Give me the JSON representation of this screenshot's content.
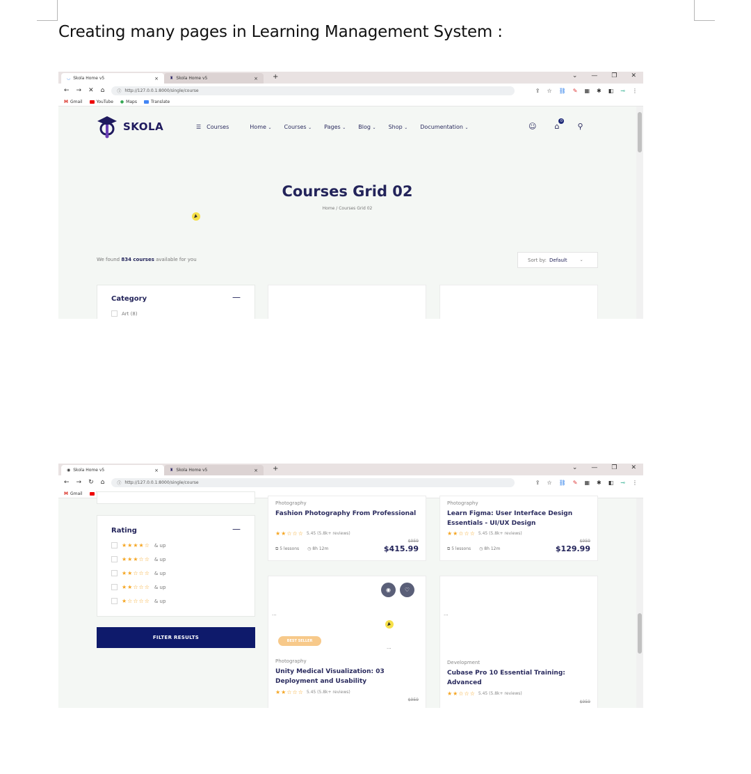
{
  "document": {
    "heading": "Creating many pages in Learning Management System :"
  },
  "browser": {
    "tab_title": "Skola Home v5",
    "tab_title_2": "Skola Home v5",
    "new_tab": "+",
    "tab_close": "×",
    "url": "http://127.0.0.1:8000/single/course",
    "bookmarks": [
      "Gmail",
      "YouTube",
      "Maps",
      "Translate"
    ],
    "window_controls": [
      "⌄",
      "—",
      "❐",
      "✕"
    ]
  },
  "site": {
    "logo_text": "SKOLA",
    "courses_button": "Courses",
    "nav": [
      "Home",
      "Courses",
      "Pages",
      "Blog",
      "Shop",
      "Documentation"
    ],
    "cart_count": "0",
    "hero_title": "Courses Grid 02",
    "breadcrumb": "Home  /  Courses Grid 02",
    "found_prefix": "We found ",
    "found_count": "834 courses",
    "found_suffix": " available for you",
    "sort_label": "Sort by: ",
    "sort_value": "Default"
  },
  "sidebar": {
    "category_title": "Category",
    "category_first": "Art (8)",
    "rating_title": "Rating",
    "rating_rows": [
      {
        "stars": "★★★★☆",
        "label": "& up"
      },
      {
        "stars": "★★★☆☆",
        "label": "& up"
      },
      {
        "stars": "★★☆☆☆",
        "label": "& up"
      },
      {
        "stars": "★★☆☆☆",
        "label": "& up"
      },
      {
        "stars": "★☆☆☆☆",
        "label": "& up"
      }
    ],
    "filter_button": "FILTER RESULTS"
  },
  "courses": [
    {
      "category": "Photography",
      "title": "Fashion Photography From Professional",
      "stars": "★★☆☆☆",
      "rating": "5.45 (5.8k+ reviews)",
      "lessons": "5 lessons",
      "duration": "8h 12m",
      "old_price": "$959",
      "price": "$415.99"
    },
    {
      "category": "Photography",
      "title": "Learn Figma: User Interface Design Essentials - UI/UX Design",
      "stars": "★★☆☆☆",
      "rating": "5.45 (5.8k+ reviews)",
      "lessons": "5 lessons",
      "duration": "8h 12m",
      "old_price": "$959",
      "price": "$129.99"
    },
    {
      "category": "Photography",
      "title": "Unity Medical Visualization: 03 Deployment and Usability",
      "stars": "★★☆☆☆",
      "rating": "5.45 (5.8k+ reviews)",
      "old_price": "$959",
      "badge": "BEST SELLER"
    },
    {
      "category": "Development",
      "title": "Cubase Pro 10 Essential Training: Advanced",
      "stars": "★★☆☆☆",
      "rating": "5.45 (5.8k+ reviews)",
      "old_price": "$959"
    }
  ],
  "broken_image_text": "..."
}
